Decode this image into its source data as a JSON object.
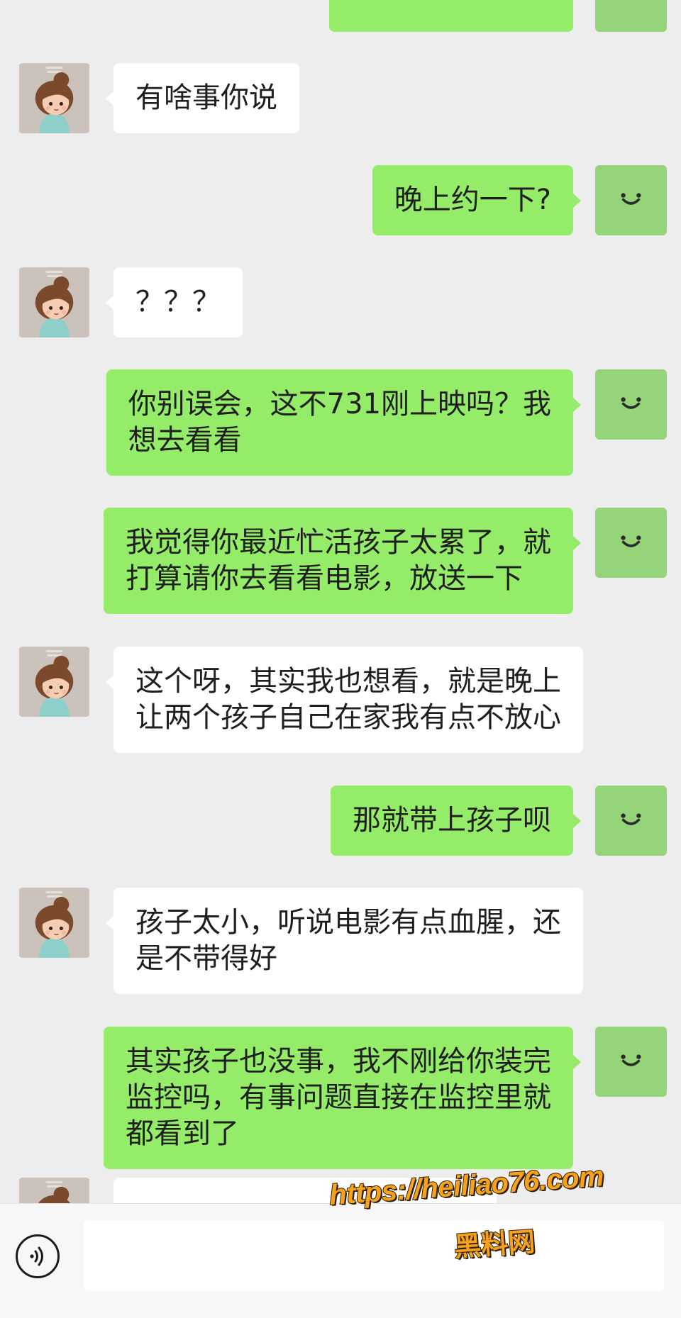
{
  "colors": {
    "background": "#ededed",
    "bubble_self": "#95ec69",
    "bubble_other": "#ffffff",
    "avatar_self": "#96d47a",
    "watermark": "#f7a21b"
  },
  "icons": {
    "other_avatar": "avatar-girl",
    "self_avatar": "smile-icon",
    "voice": "voice-icon"
  },
  "messages": [
    {
      "side": "left",
      "lines": [
        "有啥事你说"
      ]
    },
    {
      "side": "right",
      "lines": [
        "晚上约一下?"
      ]
    },
    {
      "side": "left",
      "lines": [
        "？？？"
      ]
    },
    {
      "side": "right",
      "lines": [
        "你别误会，这不731刚上映吗？我",
        "想去看看"
      ]
    },
    {
      "side": "right",
      "lines": [
        "我觉得你最近忙活孩子太累了，就",
        "打算请你去看看电影，放送一下"
      ]
    },
    {
      "side": "left",
      "lines": [
        "这个呀，其实我也想看，就是晚上",
        "让两个孩子自己在家我有点不放心"
      ]
    },
    {
      "side": "right",
      "lines": [
        "那就带上孩子呗"
      ]
    },
    {
      "side": "left",
      "lines": [
        "孩子太小，听说电影有点血腥，还",
        "是不带得好"
      ]
    },
    {
      "side": "right",
      "lines": [
        "其实孩子也没事，我不刚给你装完",
        "监控吗，有事问题直接在监控里就",
        "都看到了"
      ]
    }
  ],
  "watermark": {
    "url": "https://heiliao76.com",
    "name": "黑料网"
  }
}
